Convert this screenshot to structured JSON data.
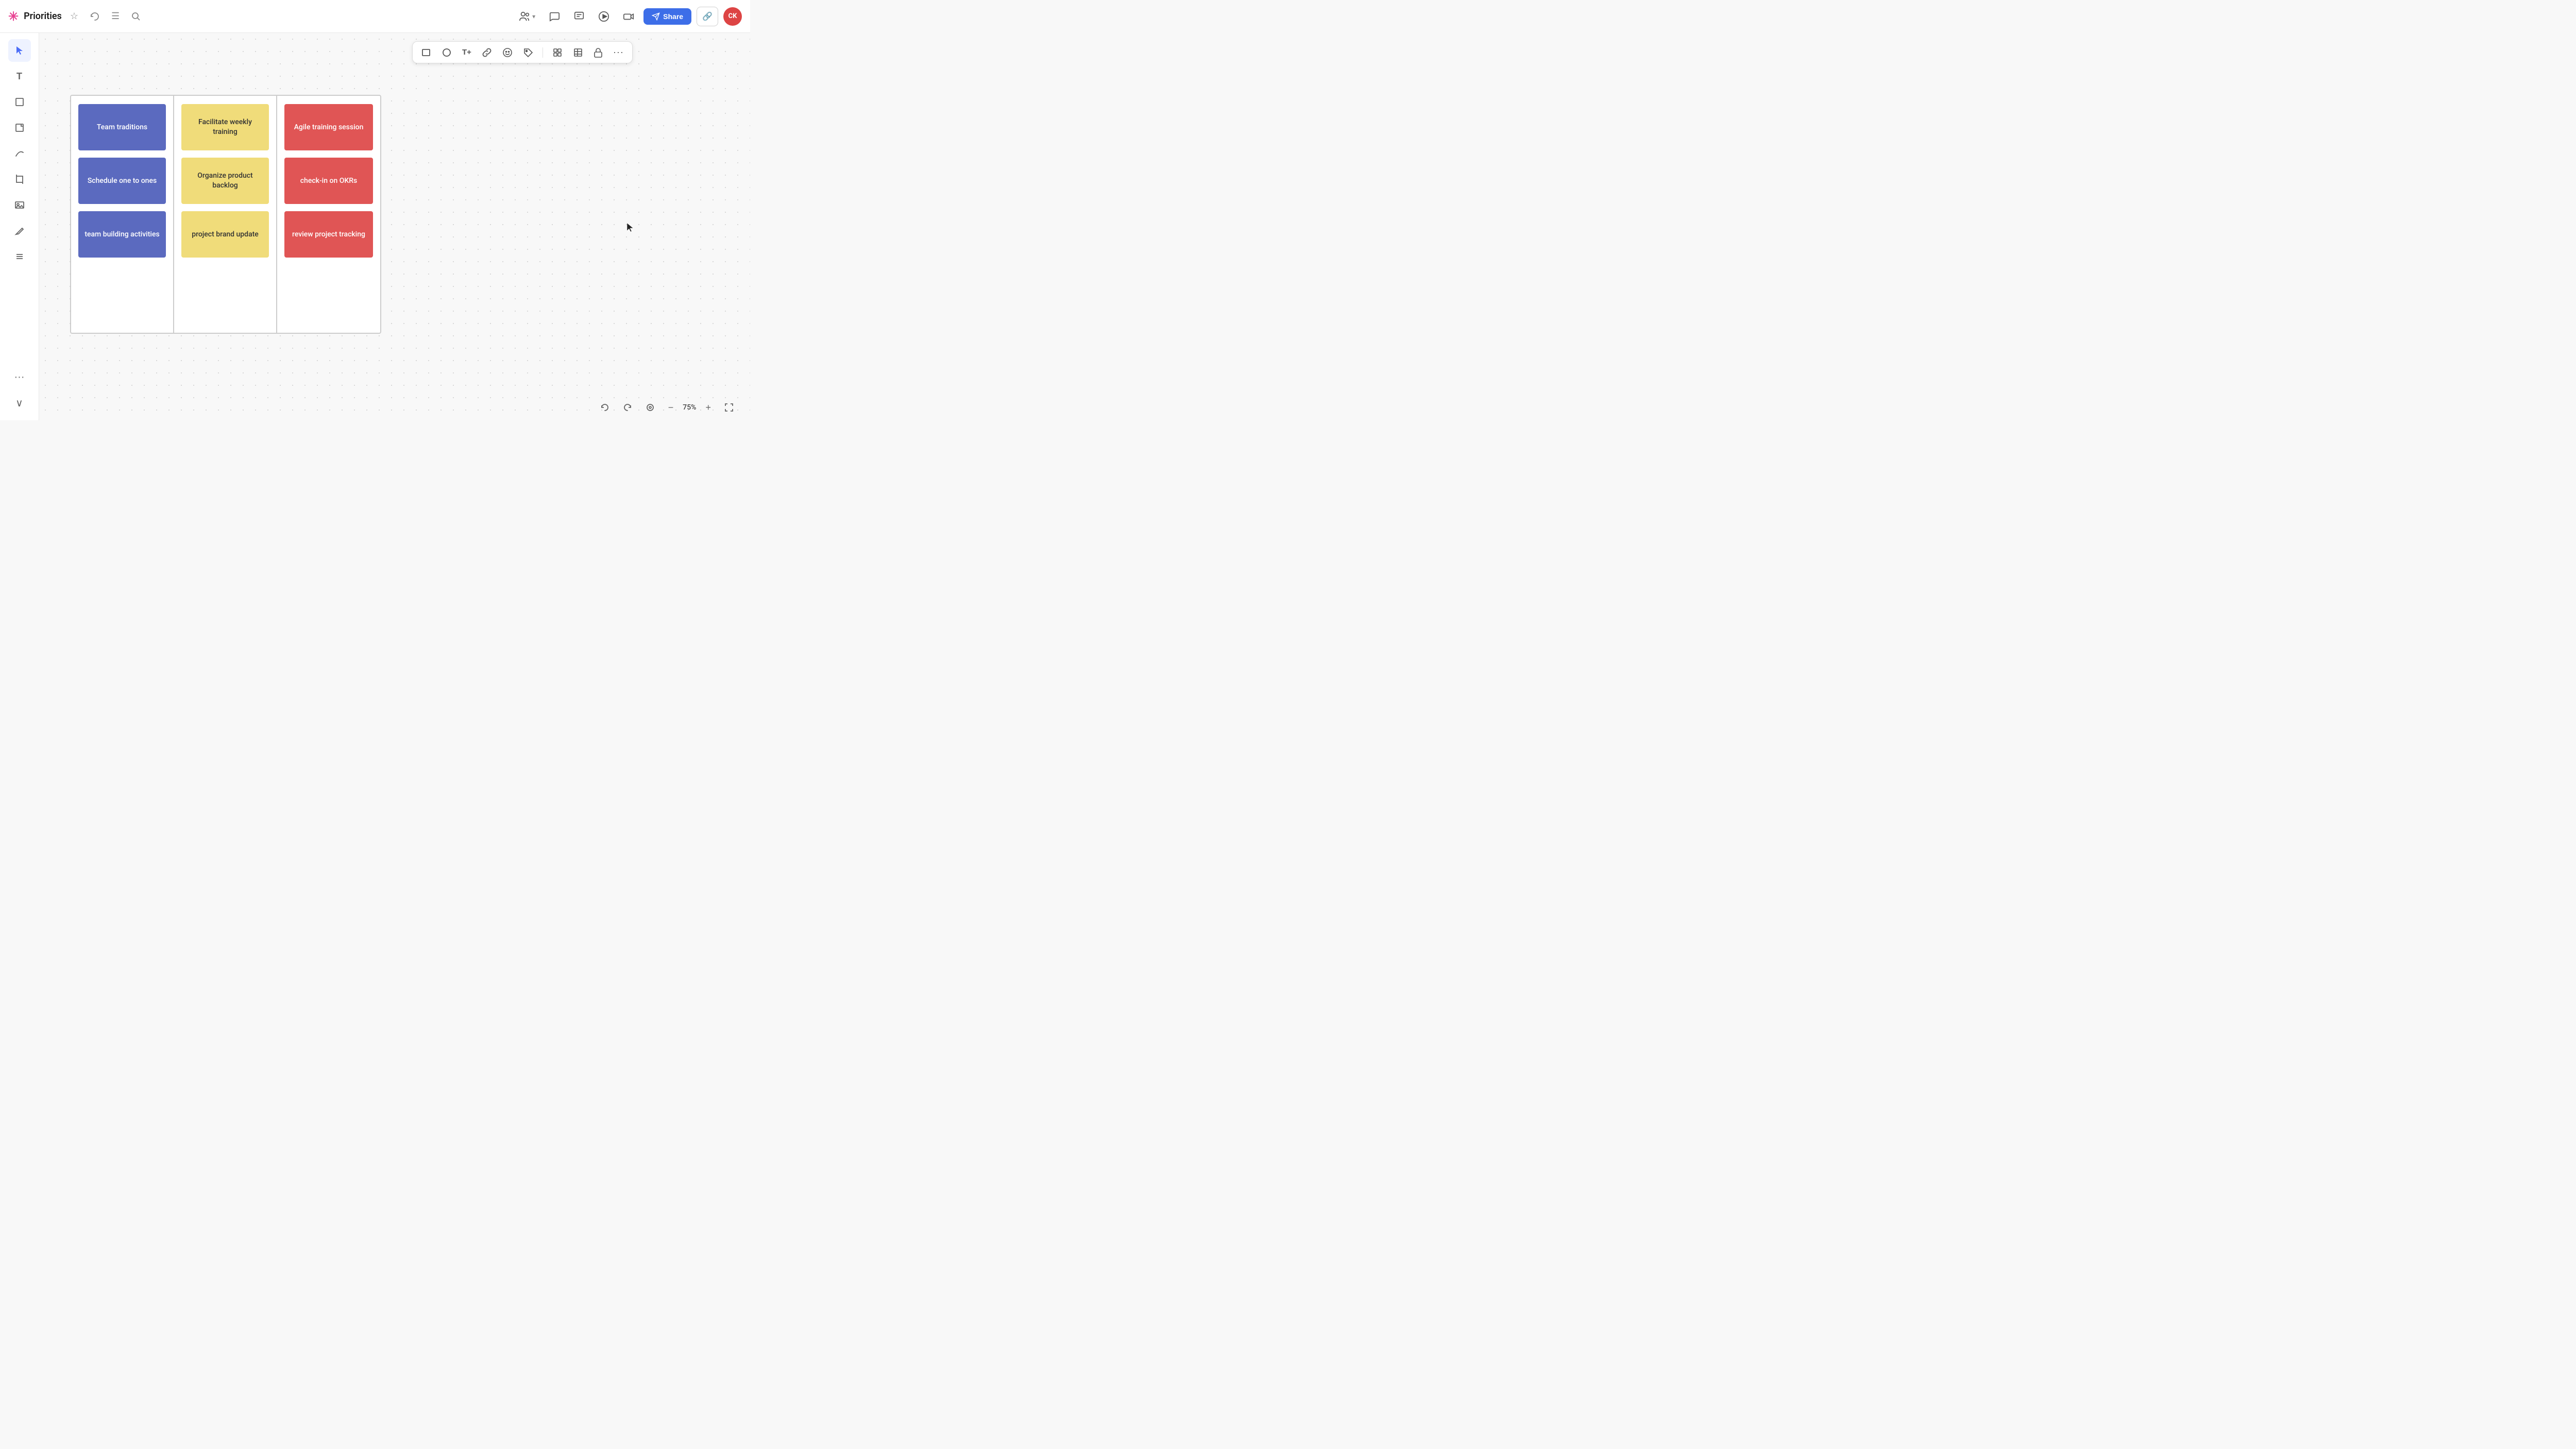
{
  "topbar": {
    "logo": "✳",
    "title": "Priorities",
    "star_label": "⭐",
    "history_label": "↺",
    "menu_label": "☰",
    "search_label": "🔍",
    "share_label": "Share",
    "avatar_label": "CK"
  },
  "floating_toolbar": {
    "tools": [
      {
        "name": "rectangle-tool",
        "icon": "▭"
      },
      {
        "name": "circle-tool",
        "icon": "○"
      },
      {
        "name": "text-tool",
        "icon": "T+"
      },
      {
        "name": "link-tool",
        "icon": "🔗"
      },
      {
        "name": "emoji-tool",
        "icon": "😊"
      },
      {
        "name": "tag-tool",
        "icon": "🏷"
      },
      {
        "name": "grid-tool",
        "icon": "⊞"
      },
      {
        "name": "table-tool",
        "icon": "⊟"
      },
      {
        "name": "lock-tool",
        "icon": "🔒"
      },
      {
        "name": "more-tool",
        "icon": "···"
      }
    ]
  },
  "sidebar": {
    "tools": [
      {
        "name": "cursor-tool",
        "icon": "↖",
        "active": true
      },
      {
        "name": "text-tool",
        "icon": "T"
      },
      {
        "name": "frame-tool",
        "icon": "⊡"
      },
      {
        "name": "sticky-tool",
        "icon": "▱"
      },
      {
        "name": "line-tool",
        "icon": "⌒"
      },
      {
        "name": "crop-tool",
        "icon": "⊠"
      },
      {
        "name": "image-tool",
        "icon": "⊞"
      },
      {
        "name": "draw-tool",
        "icon": "✏"
      },
      {
        "name": "list-tool",
        "icon": "☰"
      },
      {
        "name": "more-tool",
        "icon": "···"
      },
      {
        "name": "collapse-tool",
        "icon": "∨"
      }
    ]
  },
  "board": {
    "columns": [
      {
        "id": "col-1",
        "notes": [
          {
            "text": "Team traditions",
            "color": "blue"
          },
          {
            "text": "Schedule one to ones",
            "color": "blue"
          },
          {
            "text": "team building activities",
            "color": "blue"
          }
        ]
      },
      {
        "id": "col-2",
        "notes": [
          {
            "text": "Facilitate weekly training",
            "color": "yellow"
          },
          {
            "text": "Organize product backlog",
            "color": "yellow"
          },
          {
            "text": "project brand update",
            "color": "yellow"
          }
        ]
      },
      {
        "id": "col-3",
        "notes": [
          {
            "text": "Agile training session",
            "color": "red"
          },
          {
            "text": "check-in on OKRs",
            "color": "red"
          },
          {
            "text": "review project tracking",
            "color": "red"
          }
        ]
      }
    ]
  },
  "bottom_bar": {
    "undo_label": "←",
    "redo_label": "→",
    "center_label": "⊙",
    "zoom_out_label": "−",
    "zoom_level": "75%",
    "zoom_in_label": "+",
    "fullscreen_label": "⤢"
  }
}
